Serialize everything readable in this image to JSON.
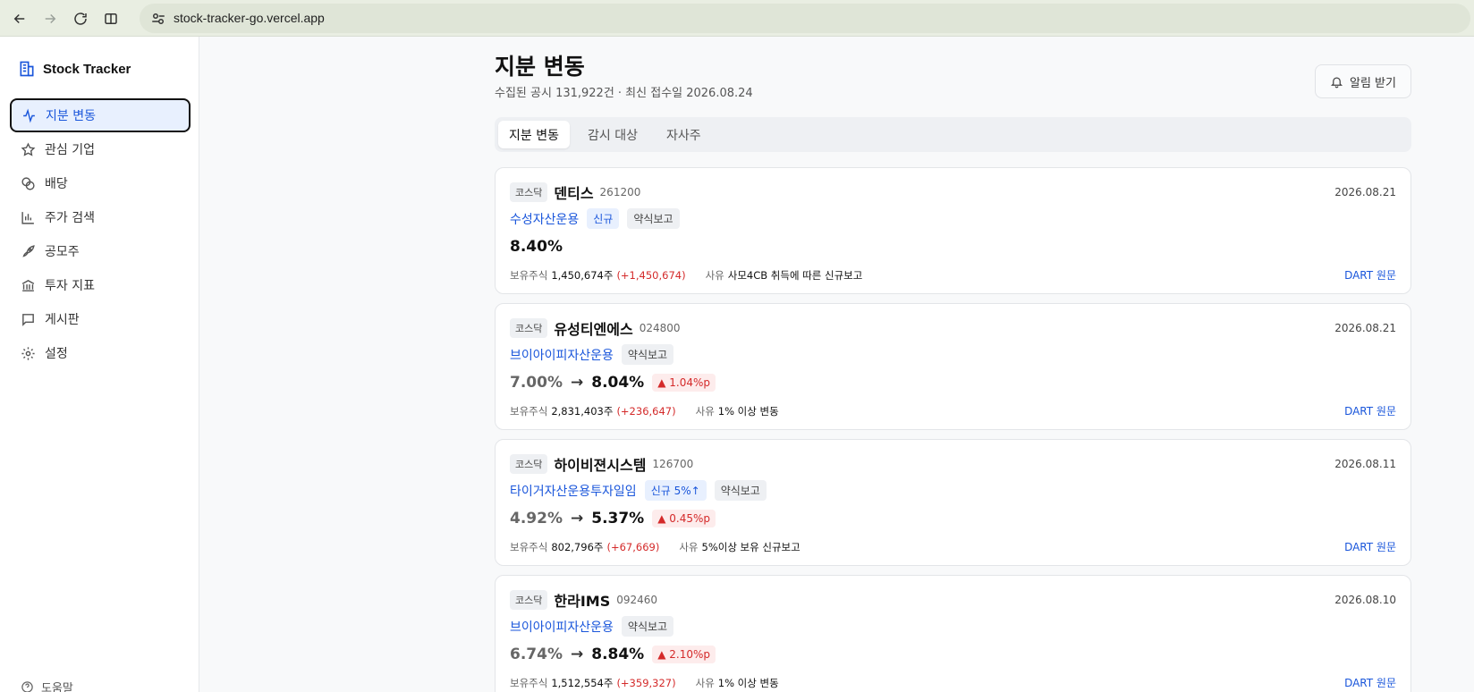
{
  "browser": {
    "url": "stock-tracker-go.vercel.app"
  },
  "sidebar": {
    "brand": "Stock Tracker",
    "items": [
      {
        "label": "지분 변동",
        "icon": "activity-icon",
        "active": true
      },
      {
        "label": "관심 기업",
        "icon": "star-icon",
        "active": false
      },
      {
        "label": "배당",
        "icon": "coins-icon",
        "active": false
      },
      {
        "label": "주가 검색",
        "icon": "chart-search-icon",
        "active": false
      },
      {
        "label": "공모주",
        "icon": "rocket-icon",
        "active": false
      },
      {
        "label": "투자 지표",
        "icon": "bank-icon",
        "active": false
      },
      {
        "label": "게시판",
        "icon": "message-square-icon",
        "active": false
      },
      {
        "label": "설정",
        "icon": "gear-icon",
        "active": false
      }
    ],
    "help": "도움말"
  },
  "header": {
    "title": "지분 변동",
    "subtitle": "수집된 공시 131,922건 · 최신 접수일 2026.08.24",
    "alert_button": "알림 받기"
  },
  "tabs": [
    {
      "label": "지분 변동",
      "active": true
    },
    {
      "label": "감시 대상",
      "active": false
    },
    {
      "label": "자사주",
      "active": false
    }
  ],
  "labels": {
    "shares": "보유주식",
    "reason": "사유",
    "dart": "DART 원문",
    "arrow": "→"
  },
  "colors": {
    "accent": "#1a56db",
    "increase": "#d42a2a"
  },
  "disclosures": [
    {
      "market": "코스닥",
      "company": "덴티스",
      "code": "261200",
      "date": "2026.08.21",
      "holder": "수성자산운용",
      "tag_new": "신규",
      "tag_report": "약식보고",
      "pct_prev": "",
      "pct_now": "8.40%",
      "delta": "",
      "shares": "1,450,674주",
      "shares_change": "(+1,450,674)",
      "reason": "사모4CB 취득에 따른 신규보고"
    },
    {
      "market": "코스닥",
      "company": "유성티엔에스",
      "code": "024800",
      "date": "2026.08.21",
      "holder": "브이아이피자산운용",
      "tag_new": "",
      "tag_report": "약식보고",
      "pct_prev": "7.00%",
      "pct_now": "8.04%",
      "delta": "▲ 1.04%p",
      "shares": "2,831,403주",
      "shares_change": "(+236,647)",
      "reason": "1% 이상 변동"
    },
    {
      "market": "코스닥",
      "company": "하이비젼시스템",
      "code": "126700",
      "date": "2026.08.11",
      "holder": "타이거자산운용투자일임",
      "tag_new": "신규 5%↑",
      "tag_report": "약식보고",
      "pct_prev": "4.92%",
      "pct_now": "5.37%",
      "delta": "▲ 0.45%p",
      "shares": "802,796주",
      "shares_change": "(+67,669)",
      "reason": "5%이상 보유 신규보고"
    },
    {
      "market": "코스닥",
      "company": "한라IMS",
      "code": "092460",
      "date": "2026.08.10",
      "holder": "브이아이피자산운용",
      "tag_new": "",
      "tag_report": "약식보고",
      "pct_prev": "6.74%",
      "pct_now": "8.84%",
      "delta": "▲ 2.10%p",
      "shares": "1,512,554주",
      "shares_change": "(+359,327)",
      "reason": "1% 이상 변동"
    }
  ]
}
